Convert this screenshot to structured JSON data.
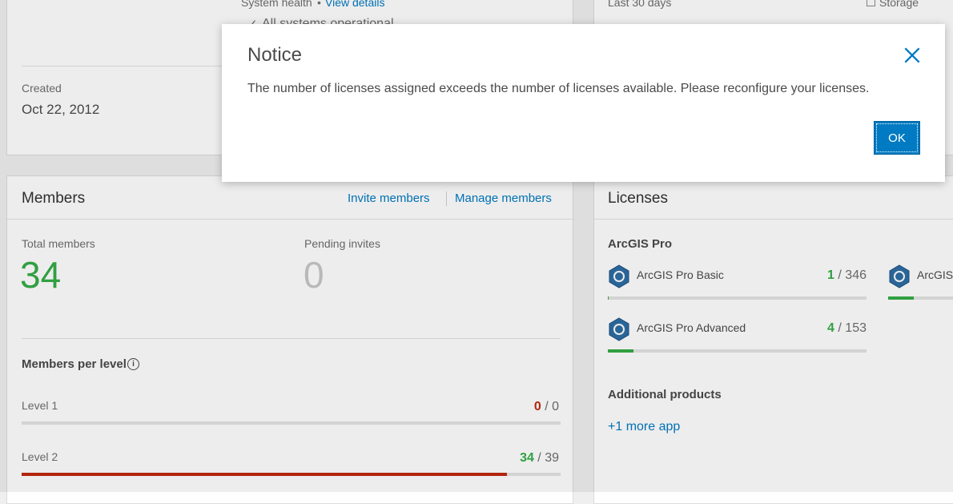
{
  "top_left_card": {
    "system_health_label": "System health",
    "separator": "•",
    "view_details_link": "View details",
    "status_text": "All systems operational",
    "created_label": "Created",
    "created_value": "Oct 22, 2012"
  },
  "top_right_card": {
    "period_label": "Last 30 days",
    "storage_legend": "Storage"
  },
  "members": {
    "title": "Members",
    "invite_link": "Invite members",
    "manage_link": "Manage members",
    "total_label": "Total members",
    "total_value": "34",
    "pending_label": "Pending invites",
    "pending_value": "0",
    "per_level_label": "Members per level",
    "levels": [
      {
        "label": "Level 1",
        "used": "0",
        "sep": " / ",
        "total": "0",
        "used_color": "#c0290f",
        "fill_fraction": 0
      },
      {
        "label": "Level 2",
        "used": "34",
        "sep": " / ",
        "total": "39",
        "used_color": "#35ac46",
        "fill_fraction": 0.87,
        "fill_color": "#c0290f"
      }
    ]
  },
  "licenses": {
    "title": "Licenses",
    "section_title": "ArcGIS Pro",
    "items": [
      {
        "name": "ArcGIS Pro Basic",
        "used": "1",
        "sep": " / ",
        "total": "346",
        "fill_fraction": 0.003
      },
      {
        "name": "ArcGIS Pro Advanced",
        "used": "4",
        "sep": " / ",
        "total": "153",
        "fill_fraction": 0.026
      },
      {
        "name": "ArcGIS",
        "fill_fraction": 0.4
      }
    ],
    "additional_title": "Additional products",
    "more_apps_link": "+1 more app"
  },
  "dialog": {
    "title": "Notice",
    "message": "The number of licenses assigned exceeds the number of licenses available. Please reconfigure your licenses.",
    "ok_label": "OK",
    "close_icon": "close-icon"
  },
  "colors": {
    "accent": "#007ac2",
    "green": "#35ac46",
    "red": "#c0290f"
  }
}
